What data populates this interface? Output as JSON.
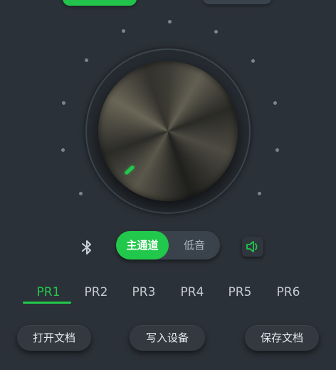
{
  "knob": {
    "indicator_color": "#22c84c"
  },
  "channel_toggle": {
    "options": [
      "主通道",
      "低音"
    ],
    "selected": "主通道"
  },
  "icons": {
    "bluetooth": "bluetooth-icon",
    "speaker": "speaker-icon"
  },
  "presets": {
    "items": [
      "PR1",
      "PR2",
      "PR3",
      "PR4",
      "PR5",
      "PR6"
    ],
    "selected": "PR1"
  },
  "actions": {
    "open_doc": "打开文档",
    "write_device": "写入设备",
    "save_doc": "保存文档"
  },
  "colors": {
    "accent": "#22c84c",
    "background": "#2b3138"
  }
}
